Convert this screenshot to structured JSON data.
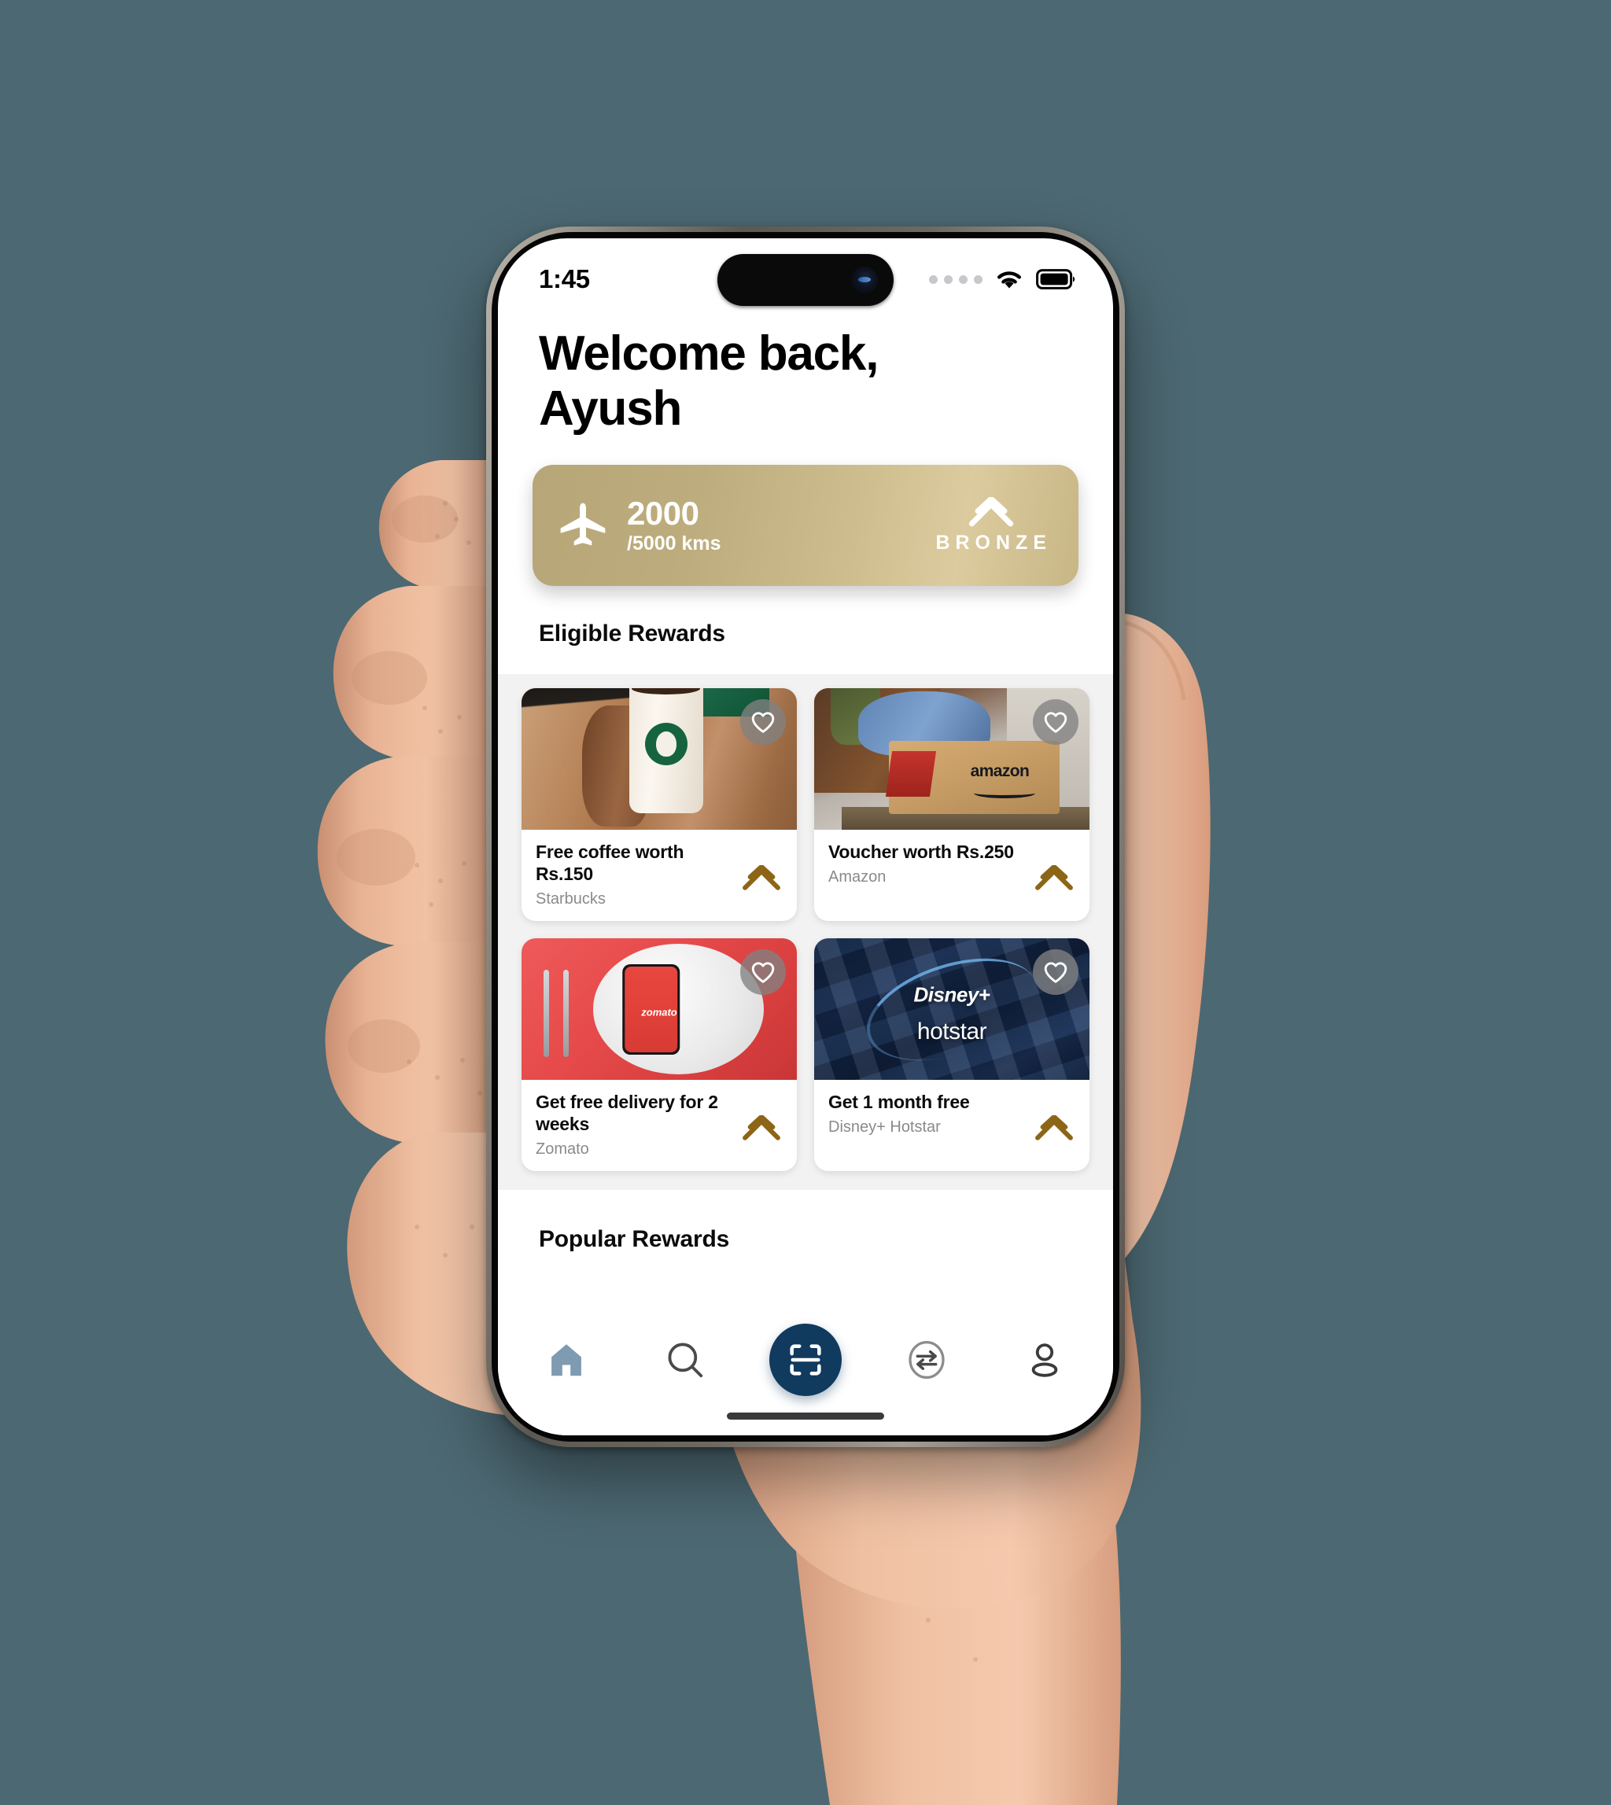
{
  "background_color": "#4C6872",
  "status_bar": {
    "time": "1:45",
    "cellular_icon": "cellular-dots-icon",
    "wifi_icon": "wifi-icon",
    "battery_icon": "battery-full-icon"
  },
  "greeting": {
    "line1": "Welcome back,",
    "line2": "Ayush"
  },
  "tier_card": {
    "plane_icon": "airplane-icon",
    "kms_earned": "2000",
    "kms_total": "/5000 kms",
    "tier_chevron_icon": "chevron-up-double-icon",
    "tier_label": "BRONZE",
    "gradient_from": "#B7A677",
    "gradient_to": "#DBCB9E"
  },
  "sections": {
    "eligible_title": "Eligible Rewards",
    "popular_title": "Popular Rewards"
  },
  "rewards": [
    {
      "title": "Free coffee worth Rs.150",
      "brand": "Starbucks",
      "thumb_class": "th-starbucks",
      "favorite_icon": "heart-outline-icon",
      "action_icon": "chevron-up-double-icon"
    },
    {
      "title": "Voucher worth Rs.250",
      "brand": "Amazon",
      "thumb_class": "th-amazon",
      "favorite_icon": "heart-outline-icon",
      "action_icon": "chevron-up-double-icon"
    },
    {
      "title": "Get free delivery for 2 weeks",
      "brand": "Zomato",
      "thumb_class": "th-zomato",
      "favorite_icon": "heart-outline-icon",
      "action_icon": "chevron-up-double-icon"
    },
    {
      "title": "Get 1 month free",
      "brand": "Disney+ Hotstar",
      "thumb_class": "th-disney",
      "favorite_icon": "heart-outline-icon",
      "action_icon": "chevron-up-double-icon"
    }
  ],
  "thumb_text": {
    "amazon_wordmark": "amazon",
    "zomato_wordmark": "zomato",
    "disney_wordmark": "Disney+",
    "hotstar_wordmark": "hotstar"
  },
  "bottom_nav": {
    "items": [
      {
        "name": "home",
        "icon": "home-icon",
        "active": true
      },
      {
        "name": "search",
        "icon": "search-icon",
        "active": false
      },
      {
        "name": "scan",
        "icon": "scan-qr-icon",
        "active": false
      },
      {
        "name": "transfer",
        "icon": "transfer-swap-icon",
        "active": false
      },
      {
        "name": "profile",
        "icon": "person-icon",
        "active": false
      }
    ],
    "active_color": "#7E9BB2",
    "scan_button_color": "#103A5E"
  },
  "accent_colors": {
    "chevron_gold": "#8C6516",
    "tier_gold": "#C0AE80",
    "navy": "#103A5E"
  }
}
